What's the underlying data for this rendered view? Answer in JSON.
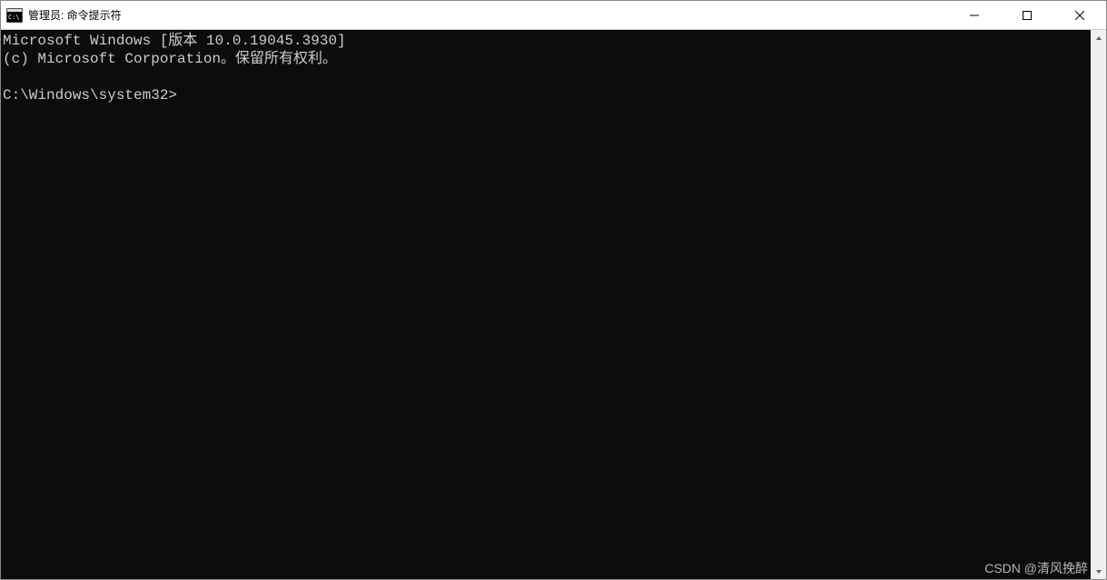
{
  "titlebar": {
    "title": "管理员: 命令提示符"
  },
  "terminal": {
    "line1": "Microsoft Windows [版本 10.0.19045.3930]",
    "line2": "(c) Microsoft Corporation。保留所有权利。",
    "prompt": "C:\\Windows\\system32>"
  },
  "watermark": "CSDN @清风挽醉"
}
